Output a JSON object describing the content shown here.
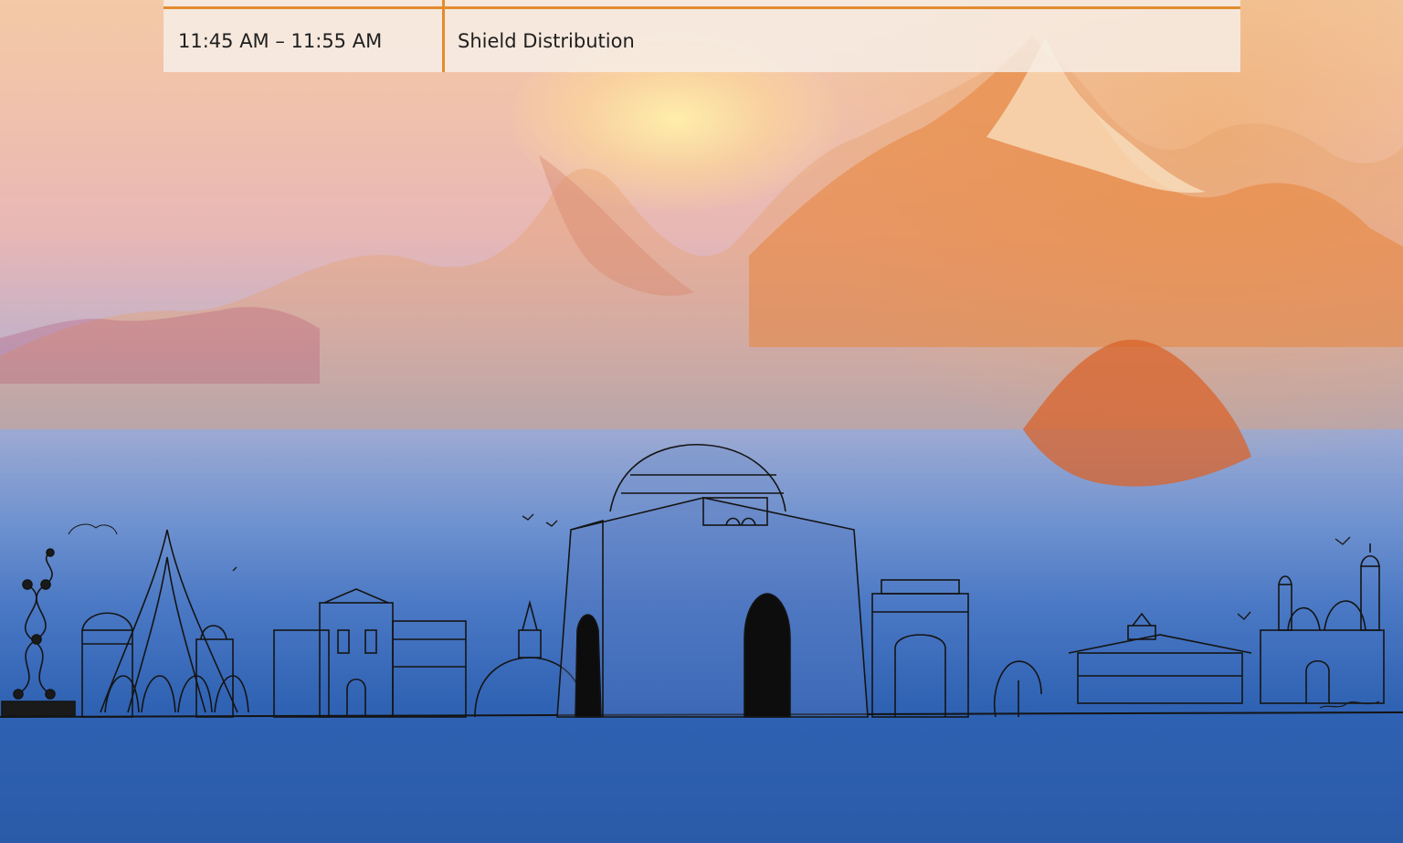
{
  "schedule": {
    "rows": [
      {
        "time": "11:45 AM – 11:55 AM",
        "event": "Shield Distribution"
      }
    ]
  },
  "colors": {
    "accent": "#e38b2e",
    "row_background": "#f6efe9",
    "sky_top": "#f3c9a6",
    "sky_bottom": "#2a5ba9"
  },
  "illustration": {
    "description_icons": [
      "mountain-icon",
      "mausoleum-icon",
      "gateway-arch-icon",
      "dome-icon",
      "stupa-icon",
      "bird-icon"
    ]
  }
}
